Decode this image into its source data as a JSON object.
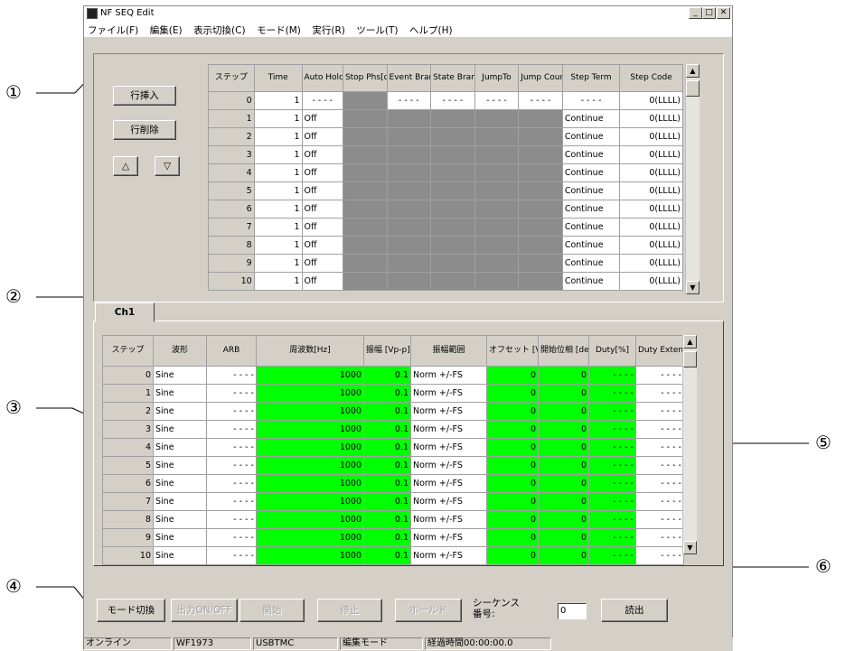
{
  "window": {
    "title": "NF SEQ Edit",
    "min_label": "_",
    "max_label": "□",
    "close_label": "✕"
  },
  "menu": [
    "ファイル(F)",
    "編集(E)",
    "表示切換(C)",
    "モード(M)",
    "実行(R)",
    "ツール(T)",
    "ヘルプ(H)"
  ],
  "side_buttons": {
    "insert": "行挿入",
    "delete": "行削除",
    "up": "△",
    "down": "▽"
  },
  "step_table": {
    "headers": [
      "ステップ",
      "Time",
      "Auto Hold",
      "Stop Phs[deg]",
      "Event Branch",
      "State Branch",
      "JumpTo",
      "Jump Count",
      "Step Term",
      "Step Code"
    ],
    "rows": [
      [
        "0",
        "1",
        "- - - -",
        "",
        "- - - -",
        "- - - -",
        "- - - -",
        "- - - -",
        "- - - -",
        "0(LLLL)"
      ],
      [
        "1",
        "1",
        "Off",
        "",
        "",
        "",
        "",
        "",
        "Continue",
        "0(LLLL)"
      ],
      [
        "2",
        "1",
        "Off",
        "",
        "",
        "",
        "",
        "",
        "Continue",
        "0(LLLL)"
      ],
      [
        "3",
        "1",
        "Off",
        "",
        "",
        "",
        "",
        "",
        "Continue",
        "0(LLLL)"
      ],
      [
        "4",
        "1",
        "Off",
        "",
        "",
        "",
        "",
        "",
        "Continue",
        "0(LLLL)"
      ],
      [
        "5",
        "1",
        "Off",
        "",
        "",
        "",
        "",
        "",
        "Continue",
        "0(LLLL)"
      ],
      [
        "6",
        "1",
        "Off",
        "",
        "",
        "",
        "",
        "",
        "Continue",
        "0(LLLL)"
      ],
      [
        "7",
        "1",
        "Off",
        "",
        "",
        "",
        "",
        "",
        "Continue",
        "0(LLLL)"
      ],
      [
        "8",
        "1",
        "Off",
        "",
        "",
        "",
        "",
        "",
        "Continue",
        "0(LLLL)"
      ],
      [
        "9",
        "1",
        "Off",
        "",
        "",
        "",
        "",
        "",
        "Continue",
        "0(LLLL)"
      ],
      [
        "10",
        "1",
        "Off",
        "",
        "",
        "",
        "",
        "",
        "Continue",
        "0(LLLL)"
      ]
    ]
  },
  "tab": {
    "label": "Ch1"
  },
  "ch_table": {
    "headers": [
      "ステップ",
      "波形",
      "ARB",
      "周波数[Hz]",
      "振幅 [Vp-p]",
      "振幅範囲",
      "オフセット [V]",
      "開始位相 [deg]",
      "Duty[%]",
      "Duty Extend"
    ],
    "rows": [
      [
        "0",
        "Sine",
        "- - - -",
        "1000",
        "0.1",
        "Norm +/-FS",
        "0",
        "0",
        "- - - -",
        "- - - -"
      ],
      [
        "1",
        "Sine",
        "- - - -",
        "1000",
        "0.1",
        "Norm +/-FS",
        "0",
        "0",
        "- - - -",
        "- - - -"
      ],
      [
        "2",
        "Sine",
        "- - - -",
        "1000",
        "0.1",
        "Norm +/-FS",
        "0",
        "0",
        "- - - -",
        "- - - -"
      ],
      [
        "3",
        "Sine",
        "- - - -",
        "1000",
        "0.1",
        "Norm +/-FS",
        "0",
        "0",
        "- - - -",
        "- - - -"
      ],
      [
        "4",
        "Sine",
        "- - - -",
        "1000",
        "0.1",
        "Norm +/-FS",
        "0",
        "0",
        "- - - -",
        "- - - -"
      ],
      [
        "5",
        "Sine",
        "- - - -",
        "1000",
        "0.1",
        "Norm +/-FS",
        "0",
        "0",
        "- - - -",
        "- - - -"
      ],
      [
        "6",
        "Sine",
        "- - - -",
        "1000",
        "0.1",
        "Norm +/-FS",
        "0",
        "0",
        "- - - -",
        "- - - -"
      ],
      [
        "7",
        "Sine",
        "- - - -",
        "1000",
        "0.1",
        "Norm +/-FS",
        "0",
        "0",
        "- - - -",
        "- - - -"
      ],
      [
        "8",
        "Sine",
        "- - - -",
        "1000",
        "0.1",
        "Norm +/-FS",
        "0",
        "0",
        "- - - -",
        "- - - -"
      ],
      [
        "9",
        "Sine",
        "- - - -",
        "1000",
        "0.1",
        "Norm +/-FS",
        "0",
        "0",
        "- - - -",
        "- - - -"
      ],
      [
        "10",
        "Sine",
        "- - - -",
        "1000",
        "0.1",
        "Norm +/-FS",
        "0",
        "0",
        "- - - -",
        "- - - -"
      ]
    ]
  },
  "bottom": {
    "mode": "モード切換",
    "output": "出力ON/OFF",
    "start": "開始",
    "stop": "停止",
    "hold": "ホールド",
    "seq_label": "シーケンス 番号:",
    "seq_value": "0",
    "read": "読出"
  },
  "status": [
    "オンライン",
    "WF1973",
    "USBTMC",
    "編集モード",
    "経過時間00:00:00.0"
  ],
  "callouts": [
    "①",
    "②",
    "③",
    "④",
    "⑤",
    "⑥"
  ],
  "colors": {
    "green": "#00ff00",
    "gray_cell": "#8c8c8c",
    "face": "#d4d0c8"
  }
}
